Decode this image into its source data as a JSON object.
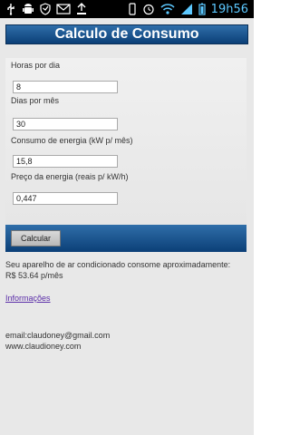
{
  "status_bar": {
    "time": "19h56"
  },
  "title": "Calculo de Consumo",
  "fields": [
    {
      "label": "Horas por dia",
      "value": "8"
    },
    {
      "label": "Dias por mês",
      "value": "30"
    },
    {
      "label": "Consumo de energia (kW p/ mês)",
      "value": "15,8"
    },
    {
      "label": "Preço da energia (reais p/ kW/h)",
      "value": "0,447"
    }
  ],
  "buttons": {
    "calculate": "Calcular"
  },
  "result": {
    "line1": "Seu aparelho de ar condicionado consome aproximadamente:",
    "line2": "R$ 53.64 p/mês"
  },
  "links": {
    "info": "Informações"
  },
  "contact": {
    "email": "email:claudoney@gmail.com",
    "site": "www.claudioney.com"
  },
  "icons": {
    "usb": "usb-icon",
    "android": "android-icon",
    "shield": "shield-icon",
    "mail": "mail-icon",
    "download": "download-icon",
    "vibrate": "vibrate-icon",
    "alarm": "alarm-icon",
    "wifi": "wifi-icon",
    "signal": "signal-icon",
    "battery": "battery-icon"
  }
}
